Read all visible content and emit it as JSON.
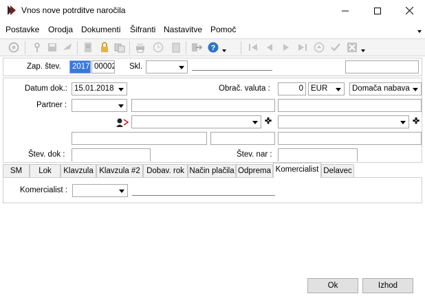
{
  "window": {
    "title": "Vnos nove potrditve naročila"
  },
  "menu": [
    {
      "label": "Postavke"
    },
    {
      "label": "Orodja"
    },
    {
      "label": "Dokumenti"
    },
    {
      "label": "Šifranti"
    },
    {
      "label": "Nastavitve"
    },
    {
      "label": "Pomoč"
    }
  ],
  "toolbar": {
    "icons": [
      "refresh-icon",
      "tag-icon",
      "save-icon",
      "check-brush-icon",
      "document-icon",
      "lock-icon",
      "copy-icon",
      "print-icon",
      "clock-icon",
      "paste-icon",
      "export-icon",
      "help-icon",
      "first-icon",
      "prev-icon",
      "next-icon",
      "last-icon",
      "up-icon",
      "confirm-icon",
      "cancel-icon"
    ]
  },
  "header": {
    "zap_label": "Zap. štev.",
    "zap_year": "2017",
    "zap_num": "00002",
    "skl_label": "Skl."
  },
  "form": {
    "datum_label": "Datum dok.:",
    "datum_value": "15.01.2018",
    "valuta_label": "Obrač. valuta :",
    "valuta_amount": "0",
    "valuta_currency": "EUR",
    "nabava": "Domača nabava",
    "partner_label": "Partner :",
    "stev_dok_label": "Štev. dok :",
    "stev_nar_label": "Štev. nar :"
  },
  "tabs": [
    {
      "label": "SM"
    },
    {
      "label": "Lok"
    },
    {
      "label": "Klavzula"
    },
    {
      "label": "Klavzula #2"
    },
    {
      "label": "Dobav. rok"
    },
    {
      "label": "Način plačila"
    },
    {
      "label": "Odprema"
    },
    {
      "label": "Komercialist",
      "active": true
    },
    {
      "label": "Delavec"
    }
  ],
  "tab_content": {
    "komercialist_label": "Komercialist :"
  },
  "buttons": {
    "ok": "Ok",
    "exit": "Izhod"
  }
}
